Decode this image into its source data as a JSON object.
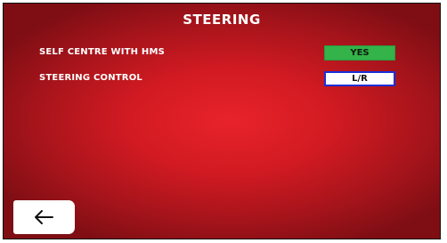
{
  "screen": {
    "title": "STEERING"
  },
  "settings": [
    {
      "label": "SELF CENTRE WITH HMS",
      "value": "YES"
    },
    {
      "label": "STEERING CONTROL",
      "value": "L/R"
    }
  ],
  "back": {
    "icon": "arrow-left-icon"
  },
  "colors": {
    "background_red": "#d21a22",
    "toggle_on_green": "#33b34a",
    "selection_border_blue": "#1a2fd6"
  }
}
